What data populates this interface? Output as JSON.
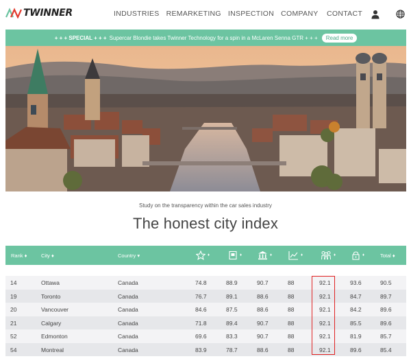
{
  "brand": {
    "name": "TWINNER",
    "accent": "#6cc4a1"
  },
  "nav": {
    "items": [
      {
        "label": "INDUSTRIES"
      },
      {
        "label": "REMARKETING"
      },
      {
        "label": "INSPECTION"
      },
      {
        "label": "COMPANY"
      }
    ],
    "contact": "CONTACT",
    "user_icon": "user-icon",
    "language_icon": "globe-icon"
  },
  "announcement": {
    "prefix": "+ + + SPECIAL + + +",
    "text": "Supercar Blondie takes Twinner Technology for a spin in a McLaren Senna GTR + + +",
    "button": "Read more"
  },
  "hero": {
    "image": "city panorama (Zurich)"
  },
  "section": {
    "subtitle": "Study on the transparency within the car sales industry",
    "title": "The honest city index"
  },
  "table": {
    "headers": {
      "rank": "Rank ♦",
      "city": "City ♦",
      "country": "Country ▾",
      "icons": [
        "star-icon",
        "book-icon",
        "bank-icon",
        "chart-icon",
        "people-icon",
        "lock-icon"
      ],
      "total": "Total ♦"
    },
    "rows": [
      {
        "rank": "14",
        "city": "Ottawa",
        "country": "Canada",
        "c1": "74.8",
        "c2": "88.9",
        "c3": "90.7",
        "c4": "88",
        "c5": "92.1",
        "c6": "93.6",
        "total": "90.5"
      },
      {
        "rank": "19",
        "city": "Toronto",
        "country": "Canada",
        "c1": "76.7",
        "c2": "89.1",
        "c3": "88.6",
        "c4": "88",
        "c5": "92.1",
        "c6": "84.7",
        "total": "89.7"
      },
      {
        "rank": "20",
        "city": "Vancouver",
        "country": "Canada",
        "c1": "84.6",
        "c2": "87.5",
        "c3": "88.6",
        "c4": "88",
        "c5": "92.1",
        "c6": "84.2",
        "total": "89.6"
      },
      {
        "rank": "21",
        "city": "Calgary",
        "country": "Canada",
        "c1": "71.8",
        "c2": "89.4",
        "c3": "90.7",
        "c4": "88",
        "c5": "92.1",
        "c6": "85.5",
        "total": "89.6"
      },
      {
        "rank": "52",
        "city": "Edmonton",
        "country": "Canada",
        "c1": "69.6",
        "c2": "83.3",
        "c3": "90.7",
        "c4": "88",
        "c5": "92.1",
        "c6": "81.9",
        "total": "85.7"
      },
      {
        "rank": "54",
        "city": "Montreal",
        "country": "Canada",
        "c1": "83.9",
        "c2": "78.7",
        "c3": "88.6",
        "c4": "88",
        "c5": "92.1",
        "c6": "89.6",
        "total": "85.4"
      }
    ],
    "highlight_color": "#e02020"
  }
}
